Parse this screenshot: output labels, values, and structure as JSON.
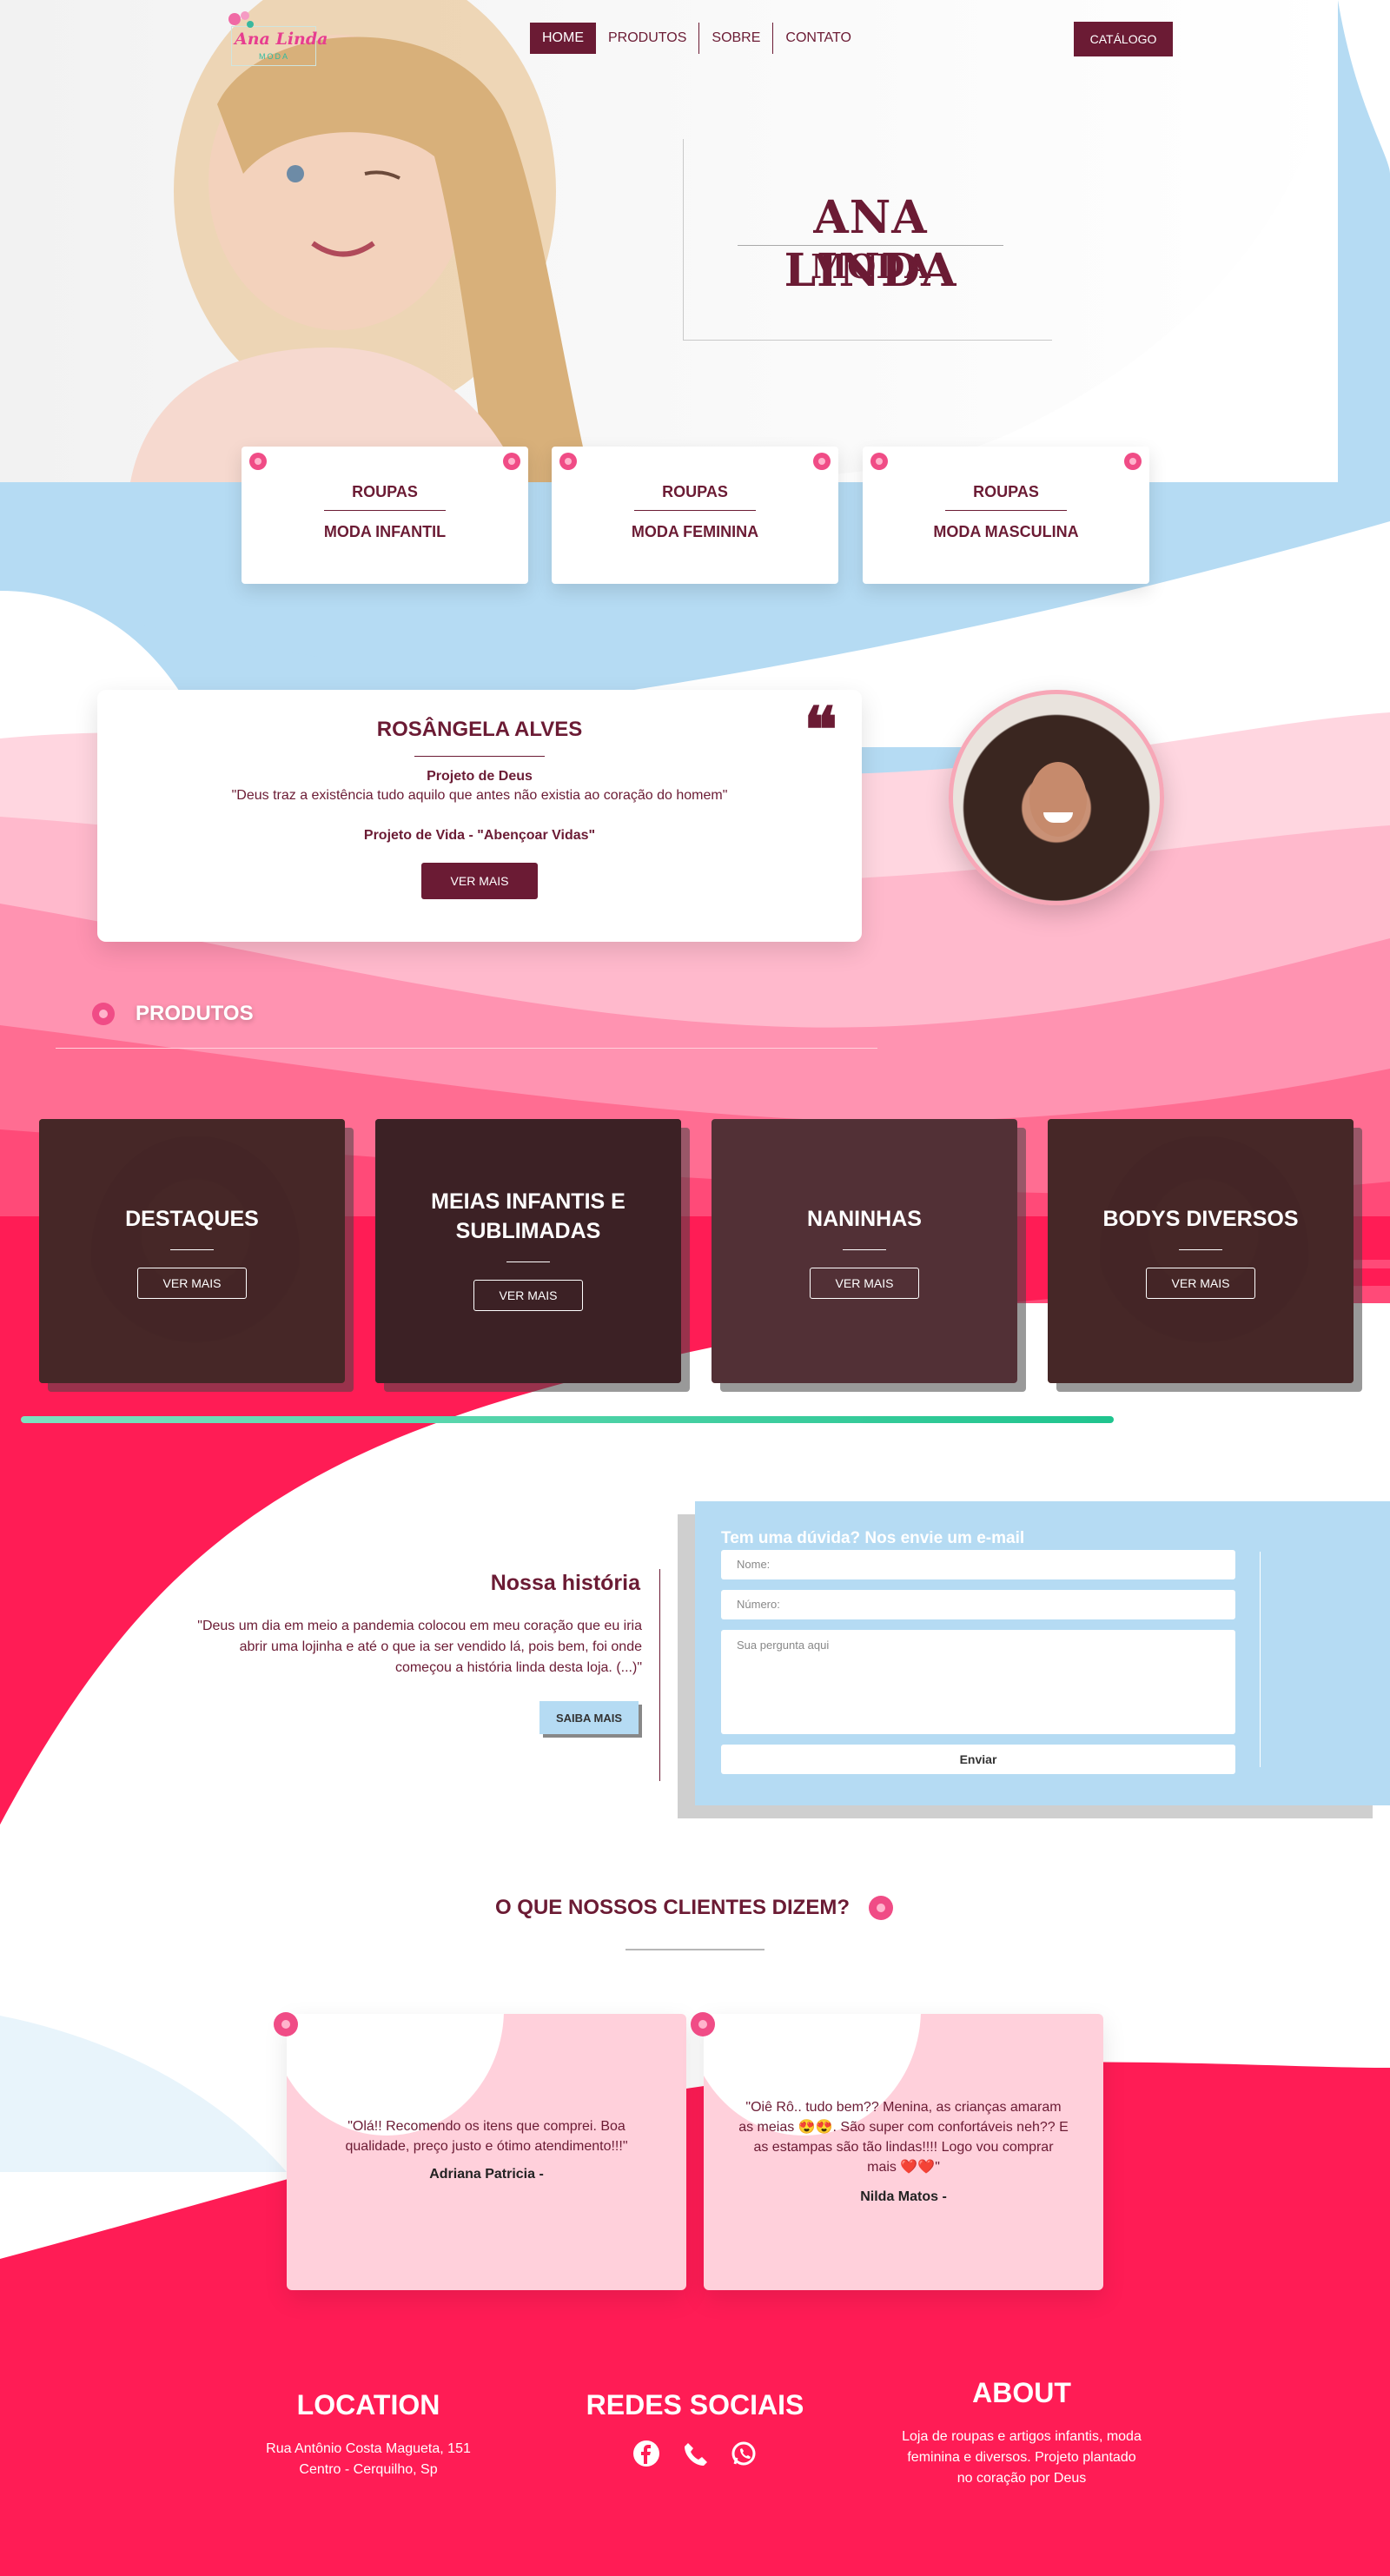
{
  "header": {
    "logo_text": "Ana Linda",
    "logo_sub": "MODA",
    "nav": [
      "HOME",
      "PRODUTOS",
      "SOBRE",
      "CONTATO"
    ],
    "catalog": "CATÁLOGO"
  },
  "hero": {
    "title": "ANA LINDA",
    "subtitle": "MODA"
  },
  "categories": [
    {
      "top": "ROUPAS",
      "bottom": "MODA INFANTIL"
    },
    {
      "top": "ROUPAS",
      "bottom": "MODA FEMININA"
    },
    {
      "top": "ROUPAS",
      "bottom": "MODA MASCULINA"
    }
  ],
  "founder": {
    "name": "ROSÂNGELA ALVES",
    "project": "Projeto de Deus",
    "quote": "\"Deus traz a existência tudo aquilo que antes não existia ao coração do homem\"",
    "vida": "Projeto de Vida - \"Abençoar Vidas\"",
    "button": "VER MAIS",
    "quote_icon": "❝"
  },
  "products": {
    "title": "PRODUTOS",
    "items": [
      {
        "title": "DESTAQUES",
        "button": "VER MAIS"
      },
      {
        "title": "MEIAS INFANTIS E SUBLIMADAS",
        "button": "VER MAIS"
      },
      {
        "title": "NANINHAS",
        "button": "VER MAIS"
      },
      {
        "title": "BODYS DIVERSOS",
        "button": "VER MAIS"
      }
    ]
  },
  "history": {
    "title": "Nossa história",
    "text": "\"Deus um dia em meio a pandemia colocou em meu coração que eu iria abrir uma lojinha e até o que ia ser vendido lá, pois bem, foi onde começou a história linda desta loja. (...)\"",
    "button": "SAIBA MAIS"
  },
  "form": {
    "title": "Tem uma dúvida? Nos envie um e-mail",
    "name_placeholder": "Nome:",
    "number_placeholder": "Número:",
    "question_placeholder": "Sua pergunta aqui",
    "send": "Enviar"
  },
  "testimonials": {
    "title": "O QUE NOSSOS CLIENTES DIZEM?",
    "items": [
      {
        "quote": "\"Olá!! Recomendo os itens que comprei. Boa qualidade, preço justo e ótimo atendimento!!!\"",
        "author": "Adriana Patricia -"
      },
      {
        "quote": "\"Oiê Rô.. tudo bem?? Menina, as crianças amaram as meias 😍😍. São super com confortáveis neh?? E as estampas são tão lindas!!!! Logo vou comprar mais ❤️❤️\"",
        "author": "Nilda Matos -"
      }
    ]
  },
  "footer": {
    "location_title": "LOCATION",
    "address1": "Rua Antônio Costa Magueta, 151",
    "address2": "Centro - Cerquilho, Sp",
    "social_title": "REDES SOCIAIS",
    "social_icons": [
      "facebook-icon",
      "phone-icon",
      "whatsapp-icon"
    ],
    "about_title": "ABOUT",
    "about_text": "Loja de roupas e artigos infantis, moda feminina e diversos. Projeto plantado no coração por Deus"
  },
  "colors": {
    "primary": "#6b1b34",
    "pink": "#ff1c55",
    "light_pink": "#ffd0db",
    "light_blue": "#b5dbf3",
    "progress": "#1fc48e"
  }
}
